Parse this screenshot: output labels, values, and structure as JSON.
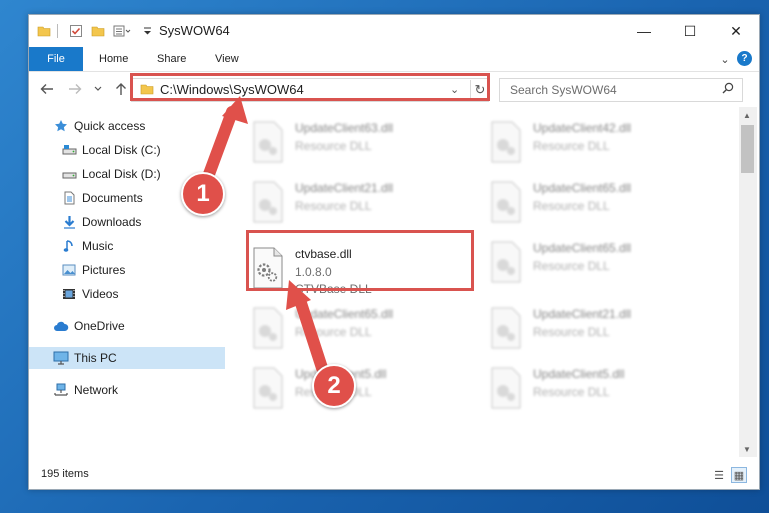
{
  "window": {
    "title": "SysWOW64",
    "controls": {
      "minimize": "—",
      "maximize": "☐",
      "close": "✕"
    }
  },
  "ribbon": {
    "tabs": [
      {
        "label": "File"
      },
      {
        "label": "Home"
      },
      {
        "label": "Share"
      },
      {
        "label": "View"
      }
    ]
  },
  "address": {
    "path": "C:\\Windows\\SysWOW64",
    "search_placeholder": "Search SysWOW64"
  },
  "nav_pane": {
    "quick_access": "Quick access",
    "items": [
      {
        "label": "Local Disk (C:)",
        "icon": "drive-icon",
        "pinned": false
      },
      {
        "label": "Local Disk (D:)",
        "icon": "drive-icon",
        "pinned": false
      },
      {
        "label": "Documents",
        "icon": "documents-icon",
        "pinned": true
      },
      {
        "label": "Downloads",
        "icon": "downloads-icon",
        "pinned": true
      },
      {
        "label": "Music",
        "icon": "music-icon",
        "pinned": true
      },
      {
        "label": "Pictures",
        "icon": "pictures-icon",
        "pinned": true
      },
      {
        "label": "Videos",
        "icon": "videos-icon",
        "pinned": true
      }
    ],
    "onedrive": "OneDrive",
    "this_pc": "This PC",
    "network": "Network"
  },
  "files": {
    "left": [
      {
        "name": "UpdateClient63.dll",
        "type": "Resource DLL"
      },
      {
        "name": "UpdateClient21.dll",
        "type": "Resource DLL"
      },
      {
        "name": "ctvbase.dll",
        "version": "1.0.8.0",
        "type": "CTVBase DLL"
      },
      {
        "name": "UpdateClient65.dll",
        "type": "Resource DLL"
      },
      {
        "name": "UpdateClient5.dll",
        "type": "Resource DLL"
      }
    ],
    "right": [
      {
        "name": "UpdateClient42.dll",
        "type": "Resource DLL"
      },
      {
        "name": "UpdateClient65.dll",
        "type": "Resource DLL"
      },
      {
        "name": "UpdateClient65.dll",
        "type": "Resource DLL"
      },
      {
        "name": "UpdateClient21.dll",
        "type": "Resource DLL"
      },
      {
        "name": "UpdateClient5.dll",
        "type": "Resource DLL"
      }
    ]
  },
  "status": {
    "items": "195 items"
  },
  "annotations": {
    "step1": "1",
    "step2": "2"
  },
  "colors": {
    "accent": "#1979ca",
    "highlight": "#d9534f",
    "badge": "#e0504a",
    "selection": "#cce4f7"
  }
}
